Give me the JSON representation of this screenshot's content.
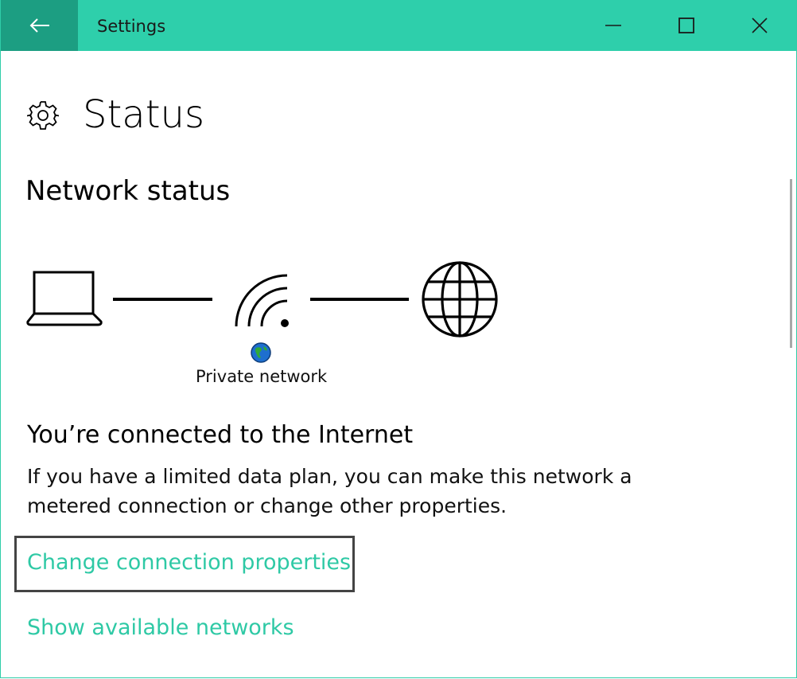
{
  "window": {
    "title": "Settings",
    "accent_color": "#2ecfab",
    "back_button_color": "#1c9e82"
  },
  "titlebar": {
    "back_icon": "arrow-left-icon",
    "minimize_icon": "minimize-icon",
    "maximize_icon": "maximize-icon",
    "close_icon": "close-icon"
  },
  "header": {
    "icon": "gear-icon",
    "title": "Status"
  },
  "network_status": {
    "section_title": "Network status",
    "diagram": {
      "device_icon": "laptop-icon",
      "network_icon": "wifi-icon",
      "network_badge_icon": "globe-badge-icon",
      "internet_icon": "globe-icon",
      "network_label": "Private network"
    },
    "connected_title": "You’re connected to the Internet",
    "description": "If you have a limited data plan, you can make this network a metered connection or change other properties."
  },
  "links": {
    "change_connection": "Change connection properties",
    "show_networks": "Show available networks",
    "link_color": "#2ec9a5"
  }
}
